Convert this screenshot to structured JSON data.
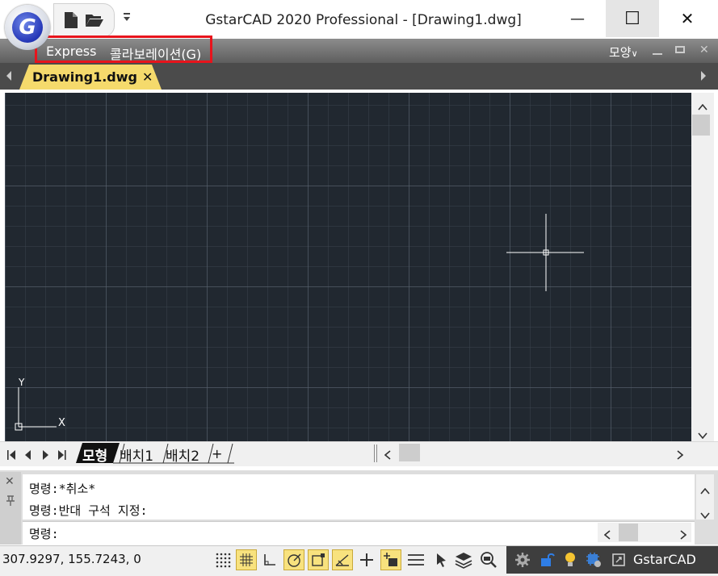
{
  "app": {
    "title": "GstarCAD 2020 Professional - [Drawing1.dwg]",
    "logo_letter": "G"
  },
  "window_controls": {
    "minimize": "—",
    "maximize": "☐",
    "close": "✕"
  },
  "quick_access": {
    "new_icon": "new-file-icon",
    "open_icon": "open-folder-icon",
    "customize_icon": "dropdown-arrow-icon"
  },
  "menubar": {
    "items": [
      {
        "label": "Express"
      },
      {
        "label": "콜라보레이션(G)"
      }
    ],
    "appearance_label": "모양"
  },
  "tabs": {
    "active": "Drawing1.dwg",
    "close": "✕"
  },
  "ucs": {
    "x_label": "X",
    "y_label": "Y"
  },
  "layout_tabs": {
    "items": [
      {
        "label": "모형"
      },
      {
        "label": "배치1"
      },
      {
        "label": "배치2"
      }
    ],
    "add": "+"
  },
  "command": {
    "history": [
      "명령:*취소*",
      "명령:반대 구석 지정:"
    ],
    "prompt": "명령:"
  },
  "status": {
    "coordinates": "307.9297, 155.7243, 0",
    "app_label": "GstarCAD"
  },
  "colors": {
    "canvas": "#212830",
    "highlight": "#e8141c",
    "tab_active": "#f5da6c",
    "toggle_on": "#f8e27e"
  }
}
